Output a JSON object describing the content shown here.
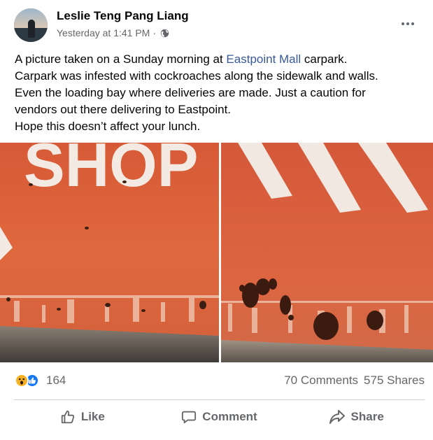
{
  "post": {
    "author": "Leslie Teng Pang Liang",
    "timestamp": "Yesterday at 1:41 PM",
    "separator": "·",
    "text_lines": {
      "l1_prefix": "A picture taken on a Sunday morning at ",
      "l1_link": "Eastpoint Mall",
      "l1_suffix": " carpark.",
      "l2": "Carpark was infested with cockroaches along the sidewalk and walls.",
      "l3": "Even the loading bay where deliveries are made. Just a caution for",
      "l4": "vendors out there delivering to Eastpoint.",
      "l5": "Hope this doesn’t affect your lunch."
    },
    "photo_left_text": "SHOP"
  },
  "stats": {
    "reaction_count": "164",
    "comments": "70 Comments",
    "shares": "575 Shares"
  },
  "actions": {
    "like": "Like",
    "comment": "Comment",
    "share": "Share"
  },
  "colors": {
    "link": "#385898",
    "like_blue": "#1877f2",
    "wow_yellow": "#f7b125",
    "wall_orange": "#d8623e"
  },
  "icons": [
    "globe-icon",
    "more-options-icon",
    "wow-reaction-icon",
    "like-reaction-icon",
    "like-icon",
    "comment-icon",
    "share-icon"
  ]
}
